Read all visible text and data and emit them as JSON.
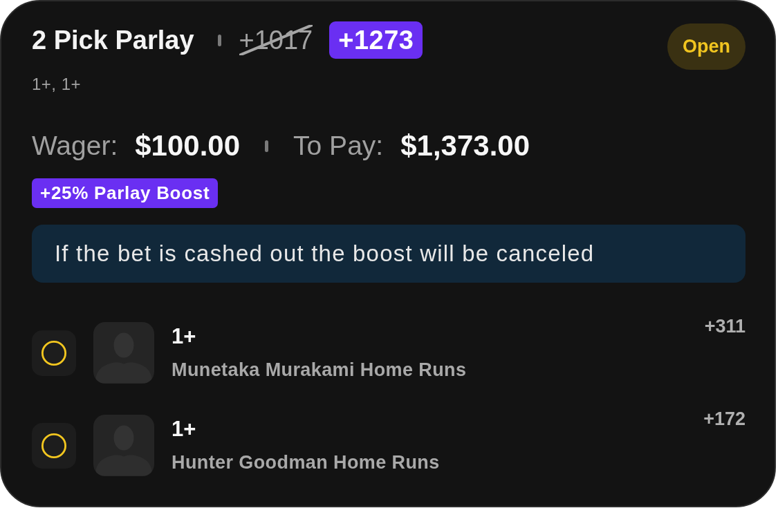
{
  "bet": {
    "title": "2 Pick Parlay",
    "original_odds": "+1017",
    "boosted_odds": "+1273",
    "status": "Open",
    "selections_summary": "1+, 1+"
  },
  "amounts": [
    {
      "label": "Wager:",
      "value": "$100.00"
    },
    {
      "label": "To Pay:",
      "value": "$1,373.00"
    }
  ],
  "boost": {
    "label": "+25% Parlay Boost"
  },
  "notice": {
    "text": "If the bet is cashed out the boost will be canceled"
  },
  "legs": [
    {
      "settled": false,
      "line": "1+",
      "market": "Munetaka Murakami Home Runs",
      "odds": "+311"
    },
    {
      "settled": false,
      "line": "1+",
      "market": "Hunter Goodman Home Runs",
      "odds": "+172"
    }
  ]
}
